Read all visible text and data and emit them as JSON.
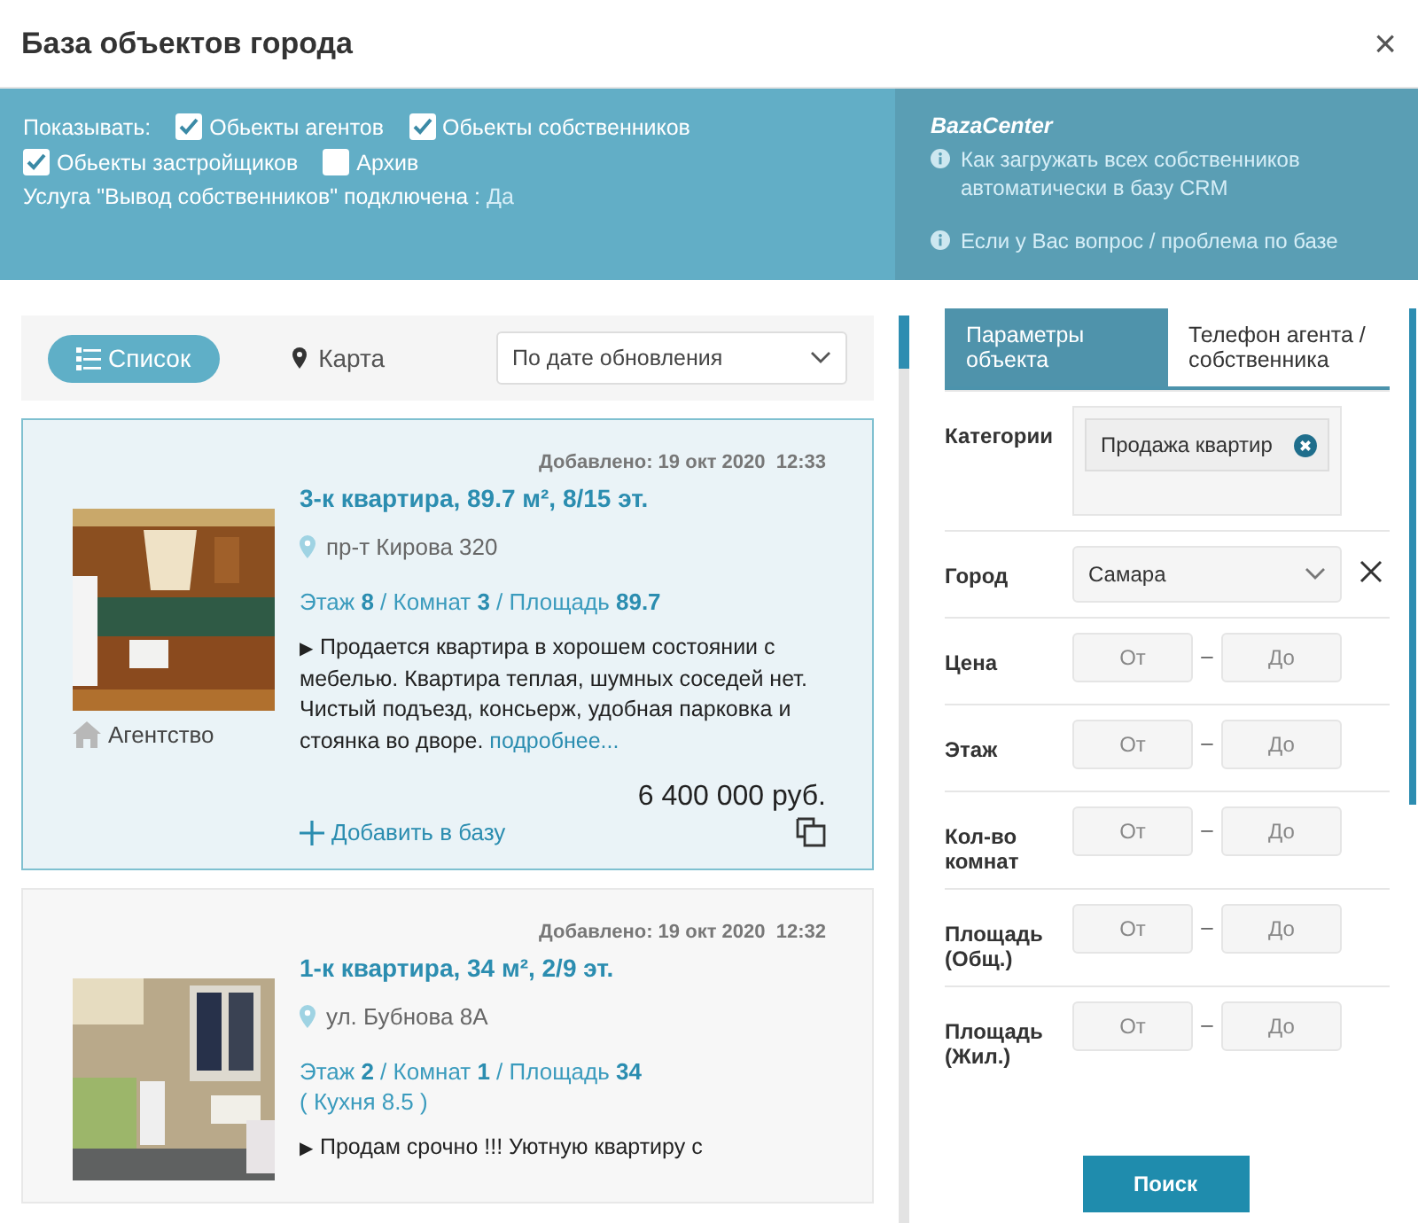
{
  "window": {
    "title": "База объектов города",
    "close": "×"
  },
  "filters": {
    "label": "Показывать:",
    "options": [
      {
        "label": "Обьекты агентов",
        "checked": true
      },
      {
        "label": "Обьекты собственников",
        "checked": true
      },
      {
        "label": "Обьекты застройщиков",
        "checked": true
      },
      {
        "label": "Архив",
        "checked": false
      }
    ],
    "service": {
      "text": "Услуга \"Вывод собственников\" подключена :",
      "value": "Да"
    }
  },
  "help": {
    "brand": "BazaCenter",
    "links": [
      "Как загружать всех собственников автоматически в базу CRM",
      "Если у Вас вопрос / проблема по базе"
    ]
  },
  "view_toggle": [
    {
      "kind": "list",
      "label": "Список",
      "selected": true
    },
    {
      "kind": "map",
      "label": "Карта",
      "selected": false
    }
  ],
  "sort": {
    "value": "По дате обновления"
  },
  "listings": [
    {
      "selected": true,
      "added": "Добавлено: 19 окт 2020  12:33",
      "title": "3-к квартира, 89.7 м², 8/15 эт.",
      "address": "пр-т Кирова 320",
      "stats": "Этаж **8** / Комнат **3** / Площадь **89.7**",
      "description": "Продается квартира в хорошем состоянии с мебелью. Квартира теплая, шумных соседей нет. Чистый подъезд, консьерж, удобная парковка и стоянка во дворе.",
      "bullet": "▶",
      "more": "подробнее...",
      "source": "Агентство",
      "price": "6 400 000 руб.",
      "add": "Добавить в базу"
    },
    {
      "selected": false,
      "added": "Добавлено: 19 окт 2020  12:32",
      "title": "1-к квартира, 34 м², 2/9 эт.",
      "address": "ул. Бубнова 8А",
      "stats": "Этаж **2** / Комнат **1** / Площадь **34**",
      "kitchen": "( Кухня 8.5 )",
      "bullet": "▶",
      "description": "Продам срочно !!! Уютную квартиру с"
    }
  ],
  "filter_panel": {
    "tabs": [
      {
        "label": "Параметры объекта",
        "selected": true
      },
      {
        "label": "Телефон агента / собственника",
        "selected": false
      }
    ],
    "rows": [
      {
        "kind": "tags",
        "label": "Категории",
        "tags": [
          "Продажа квартир"
        ]
      },
      {
        "kind": "select",
        "label": "Город",
        "value": "Самара"
      },
      {
        "kind": "range",
        "label": "Цена",
        "from": {
          "placeholder": "От"
        },
        "to": {
          "placeholder": "До"
        }
      },
      {
        "kind": "range",
        "label": "Этаж",
        "from": {
          "placeholder": "От"
        },
        "to": {
          "placeholder": "До"
        }
      },
      {
        "kind": "range",
        "label": "Кол-во комнат",
        "from": {
          "placeholder": "От"
        },
        "to": {
          "placeholder": "До"
        }
      },
      {
        "kind": "range",
        "label": "Площадь (Общ.)",
        "from": {
          "placeholder": "От"
        },
        "to": {
          "placeholder": "До"
        }
      },
      {
        "kind": "range",
        "label": "Площадь (Жил.)",
        "from": {
          "placeholder": "От"
        },
        "to": {
          "placeholder": "До"
        }
      }
    ],
    "range_separator": "–",
    "search_button": "Поиск"
  }
}
